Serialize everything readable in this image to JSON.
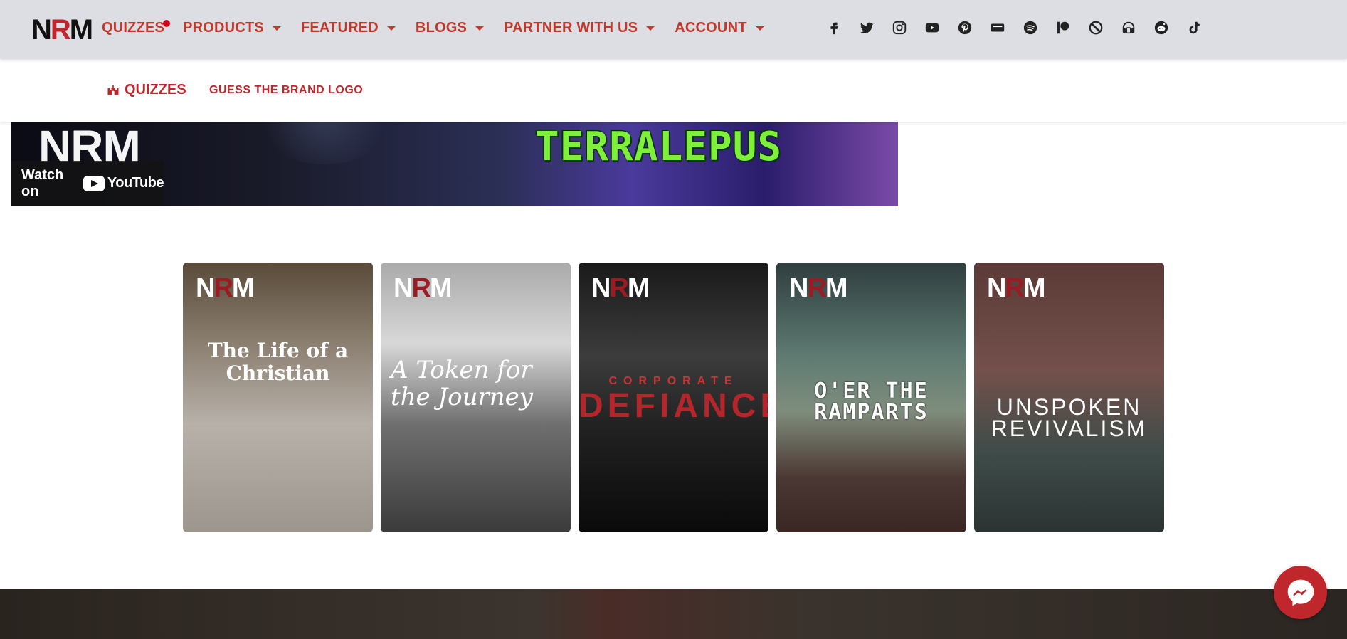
{
  "nav": {
    "logo_n": "N",
    "logo_r": "R",
    "logo_m": "M",
    "items": [
      {
        "label": "QUIZZES"
      },
      {
        "label": "PRODUCTS"
      },
      {
        "label": "FEATURED"
      },
      {
        "label": "BLOGS"
      },
      {
        "label": "PARTNER WITH US"
      },
      {
        "label": "ACCOUNT"
      }
    ],
    "social_icons": [
      "facebook-icon",
      "twitter-icon",
      "instagram-icon",
      "youtube-icon",
      "pinterest-icon",
      "imdb-icon",
      "spotify-icon",
      "patreon-icon",
      "blocked-icon",
      "podcast-icon",
      "reddit-icon",
      "tiktok-icon"
    ],
    "accent_color": "#c0392b"
  },
  "subnav": {
    "section_label": "QUIZZES",
    "link_label": "GUESS THE BRAND LOGO"
  },
  "video": {
    "channel_mark": "NRM",
    "title_art": "TERRALEPUS",
    "watch_label": "Watch on",
    "youtube_label": "YouTube"
  },
  "cards": [
    {
      "badge_n": "N",
      "badge_r": "R",
      "badge_m": "M",
      "title": "The Life of a Christian"
    },
    {
      "badge_n": "N",
      "badge_r": "R",
      "badge_m": "M",
      "title": "A Token for the Journey"
    },
    {
      "badge_n": "N",
      "badge_r": "R",
      "badge_m": "M",
      "subtitle": "CORPORATE",
      "title": "DEFIANCE"
    },
    {
      "badge_n": "N",
      "badge_r": "R",
      "badge_m": "M",
      "title": "O'ER THE RAMPARTS"
    },
    {
      "badge_n": "N",
      "badge_r": "R",
      "badge_m": "M",
      "title": "UNSPOKEN REVIVALISM"
    }
  ],
  "messenger": {
    "icon": "messenger-icon",
    "color": "#c0272d"
  }
}
